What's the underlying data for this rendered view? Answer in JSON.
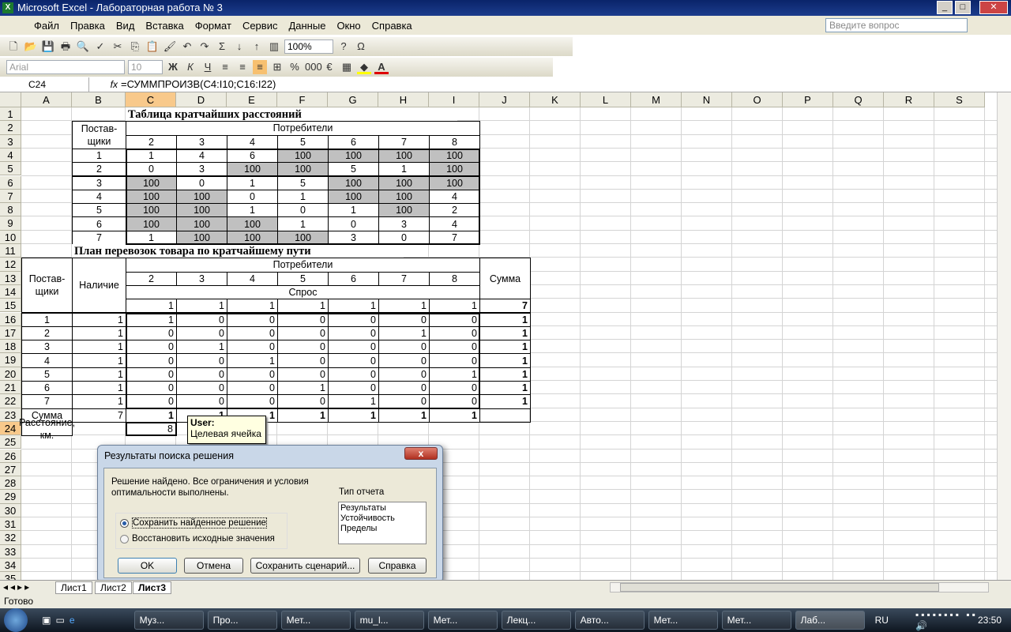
{
  "window": {
    "title": "Microsoft Excel - Лабораторная работа № 3"
  },
  "menu": {
    "items": [
      "Файл",
      "Правка",
      "Вид",
      "Вставка",
      "Формат",
      "Сервис",
      "Данные",
      "Окно",
      "Справка"
    ],
    "help_placeholder": "Введите вопрос"
  },
  "toolbar": {
    "zoom": "100%",
    "font": "Arial",
    "size": "10"
  },
  "formula_bar": {
    "name_box": "C24",
    "fx": "fx",
    "formula": "=СУММПРОИЗВ(C4:I10;C16:I22)"
  },
  "sheet": {
    "columns": [
      "A",
      "B",
      "C",
      "D",
      "E",
      "F",
      "G",
      "H",
      "I",
      "J",
      "K",
      "L",
      "M",
      "N",
      "O",
      "P",
      "Q",
      "R",
      "S"
    ],
    "selected_column": "C",
    "selected_row": 24,
    "cells": {
      "C1": "Таблица кратчайших расстояний",
      "B2": "Постав-\nщики",
      "C2": "Потребители",
      "C3": "2",
      "D3": "3",
      "E3": "4",
      "F3": "5",
      "G3": "6",
      "H3": "7",
      "I3": "8",
      "B4": "1",
      "C4": "1",
      "D4": "4",
      "E4": "6",
      "F4": "100",
      "G4": "100",
      "H4": "100",
      "I4": "100",
      "B5": "2",
      "C5": "0",
      "D5": "3",
      "E5": "100",
      "F5": "100",
      "G5": "5",
      "H5": "1",
      "I5": "100",
      "B6": "3",
      "C6": "100",
      "D6": "0",
      "E6": "1",
      "F6": "5",
      "G6": "100",
      "H6": "100",
      "I6": "100",
      "B7": "4",
      "C7": "100",
      "D7": "100",
      "E7": "0",
      "F7": "1",
      "G7": "100",
      "H7": "100",
      "I7": "4",
      "B8": "5",
      "C8": "100",
      "D8": "100",
      "E8": "1",
      "F8": "0",
      "G8": "1",
      "H8": "100",
      "I8": "2",
      "B9": "6",
      "C9": "100",
      "D9": "100",
      "E9": "100",
      "F9": "1",
      "G9": "0",
      "H9": "3",
      "I9": "4",
      "B10": "7",
      "C10": "1",
      "D10": "100",
      "E10": "100",
      "F10": "100",
      "G10": "3",
      "H10": "0",
      "I10": "7",
      "B11": "План перевозок товара по кратчайшему пути",
      "A12": "Постав-\nщики",
      "B12": "Наличие",
      "C12": "Потребители",
      "J12": "Сумма",
      "C13": "2",
      "D13": "3",
      "E13": "4",
      "F13": "5",
      "G13": "6",
      "H13": "7",
      "I13": "8",
      "C14": "Спрос",
      "C15": "1",
      "D15": "1",
      "E15": "1",
      "F15": "1",
      "G15": "1",
      "H15": "1",
      "I15": "1",
      "J15": "7",
      "A16": "1",
      "B16": "1",
      "C16": "1",
      "D16": "0",
      "E16": "0",
      "F16": "0",
      "G16": "0",
      "H16": "0",
      "I16": "0",
      "J16": "1",
      "A17": "2",
      "B17": "1",
      "C17": "0",
      "D17": "0",
      "E17": "0",
      "F17": "0",
      "G17": "0",
      "H17": "1",
      "I17": "0",
      "J17": "1",
      "A18": "3",
      "B18": "1",
      "C18": "0",
      "D18": "1",
      "E18": "0",
      "F18": "0",
      "G18": "0",
      "H18": "0",
      "I18": "0",
      "J18": "1",
      "A19": "4",
      "B19": "1",
      "C19": "0",
      "D19": "0",
      "E19": "1",
      "F19": "0",
      "G19": "0",
      "H19": "0",
      "I19": "0",
      "J19": "1",
      "A20": "5",
      "B20": "1",
      "C20": "0",
      "D20": "0",
      "E20": "0",
      "F20": "0",
      "G20": "0",
      "H20": "0",
      "I20": "1",
      "J20": "1",
      "A21": "6",
      "B21": "1",
      "C21": "0",
      "D21": "0",
      "E21": "0",
      "F21": "1",
      "G21": "0",
      "H21": "0",
      "I21": "0",
      "J21": "1",
      "A22": "7",
      "B22": "1",
      "C22": "0",
      "D22": "0",
      "E22": "0",
      "F22": "0",
      "G22": "1",
      "H22": "0",
      "I22": "0",
      "J22": "1",
      "A23": "Сумма",
      "B23": "7",
      "C23": "1",
      "D23": "1",
      "E23": "1",
      "F23": "1",
      "G23": "1",
      "H23": "1",
      "I23": "1",
      "A24": "Расстояние, км.",
      "C24": "8"
    }
  },
  "comment": {
    "author": "User:",
    "text": "Целевая ячейка"
  },
  "dialog": {
    "title": "Результаты поиска решения",
    "message": "Решение найдено. Все ограничения и условия оптимальности выполнены.",
    "report_label": "Тип отчета",
    "reports": [
      "Результаты",
      "Устойчивость",
      "Пределы"
    ],
    "options": [
      "Сохранить найденное решение",
      "Восстановить исходные значения"
    ],
    "selected_option": 0,
    "buttons": {
      "ok": "OK",
      "cancel": "Отмена",
      "save": "Сохранить сценарий...",
      "help": "Справка"
    }
  },
  "sheet_tabs": {
    "tabs": [
      "Лист1",
      "Лист2",
      "Лист3"
    ],
    "active": "Лист3"
  },
  "status": {
    "text": "Готово"
  },
  "taskbar": {
    "items": [
      "Муз...",
      "Про...",
      "Мет...",
      "mu_l...",
      "Мет...",
      "Лекц...",
      "Авто...",
      "Мет...",
      "Мет...",
      "Лаб..."
    ],
    "active": "Лаб...",
    "lang": "RU",
    "clock": "23:50"
  }
}
